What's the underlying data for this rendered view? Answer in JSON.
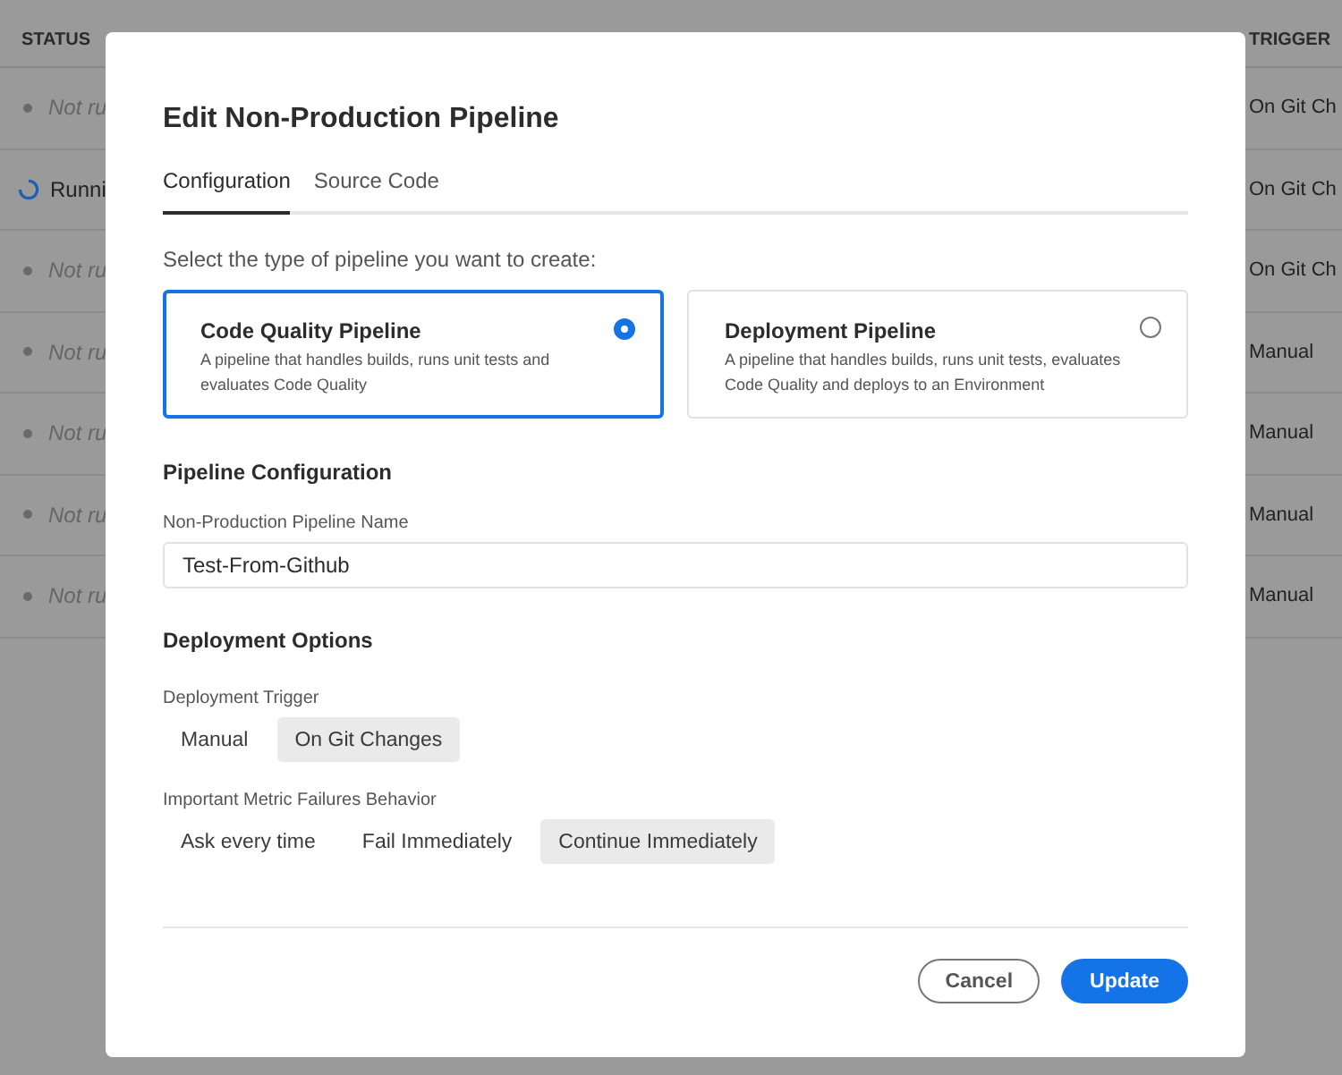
{
  "background_table": {
    "columns": [
      "STATUS",
      "TRIGGER"
    ],
    "rows": [
      {
        "kind": "idle",
        "status": "Not ru",
        "trigger": "On Git Ch"
      },
      {
        "kind": "running",
        "status": "Runni",
        "trigger": "On Git Ch"
      },
      {
        "kind": "idle",
        "status": "Not ru",
        "trigger": "On Git Ch"
      },
      {
        "kind": "idle",
        "status": "Not ru",
        "trigger": "Manual"
      },
      {
        "kind": "idle",
        "status": "Not ru",
        "trigger": "Manual"
      },
      {
        "kind": "idle",
        "status": "Not ru",
        "trigger": "Manual"
      },
      {
        "kind": "idle",
        "status": "Not ru",
        "trigger": "Manual"
      }
    ]
  },
  "dialog": {
    "title": "Edit Non-Production Pipeline",
    "tabs": [
      {
        "label": "Configuration",
        "selected": true
      },
      {
        "label": "Source Code",
        "selected": false
      }
    ],
    "prompt": "Select the type of pipeline you want to create:",
    "pipeline_types": [
      {
        "title": "Code Quality Pipeline",
        "description": "A pipeline that handles builds, runs unit tests and evaluates Code Quality",
        "selected": true
      },
      {
        "title": "Deployment Pipeline",
        "description": "A pipeline that handles builds, runs unit tests, evaluates Code Quality and deploys to an Environment",
        "selected": false
      }
    ],
    "config_heading": "Pipeline Configuration",
    "name_field": {
      "label": "Non-Production Pipeline Name",
      "value": "Test-From-Github"
    },
    "options_heading": "Deployment Options",
    "option_groups": [
      {
        "label": "Deployment Trigger",
        "options": [
          {
            "label": "Manual",
            "selected": false
          },
          {
            "label": "On Git Changes",
            "selected": true
          }
        ]
      },
      {
        "label": "Important Metric Failures Behavior",
        "options": [
          {
            "label": "Ask every time",
            "selected": false
          },
          {
            "label": "Fail Immediately",
            "selected": false
          },
          {
            "label": "Continue Immediately",
            "selected": true
          }
        ]
      }
    ],
    "buttons": [
      {
        "label": "Cancel",
        "kind": "secondary"
      },
      {
        "label": "Update",
        "kind": "primary"
      }
    ]
  }
}
